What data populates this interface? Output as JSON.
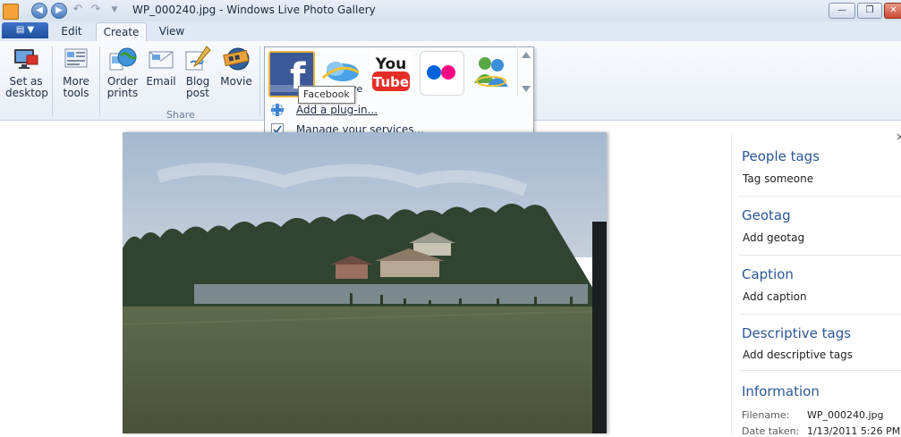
{
  "window": {
    "title": "WP_000240.jpg - Windows Live Photo Gallery"
  },
  "tabs": [
    {
      "label": "Edit"
    },
    {
      "label": "Create"
    },
    {
      "label": "View"
    }
  ],
  "ribbon": {
    "set_desktop": "Set as\ndesktop",
    "more_tools": "More\ntools",
    "order_prints": "Order\nprints",
    "email": "Email",
    "blog_post": "Blog\npost",
    "movie": "Movie",
    "share_group": "Share"
  },
  "share_menu": {
    "services": [
      {
        "name": "Facebook",
        "icon": "facebook-icon"
      },
      {
        "name": "SkyDrive",
        "icon": "skydrive-icon"
      },
      {
        "name": "YouTube",
        "icon": "youtube-icon"
      },
      {
        "name": "Flickr",
        "icon": "flickr-icon"
      },
      {
        "name": "Messenger",
        "icon": "messenger-icon"
      }
    ],
    "skydrive_partial_label": "ve",
    "youtube_you": "You",
    "youtube_tube": "Tube",
    "facebook_letter": "f",
    "tooltip": "Facebook",
    "add_plugin": "Add a plug-in...",
    "manage_services": "Manage your services..."
  },
  "info_pane": {
    "people_tags": {
      "heading": "People tags",
      "action": "Tag someone"
    },
    "geotag": {
      "heading": "Geotag",
      "action": "Add geotag"
    },
    "caption": {
      "heading": "Caption",
      "action": "Add caption"
    },
    "descriptive_tags": {
      "heading": "Descriptive tags",
      "action": "Add descriptive tags"
    },
    "information": {
      "heading": "Information",
      "filename_label": "Filename:",
      "filename_value": "WP_000240.jpg",
      "date_label": "Date taken:",
      "date_value": "1/13/2011  5:26 PM"
    },
    "close_glyph": "×"
  },
  "colors": {
    "accent": "#2b5797",
    "facebook": "#3b5998",
    "youtube": "#e52d27",
    "flickr_blue": "#0063dc",
    "flickr_pink": "#ff0084"
  }
}
